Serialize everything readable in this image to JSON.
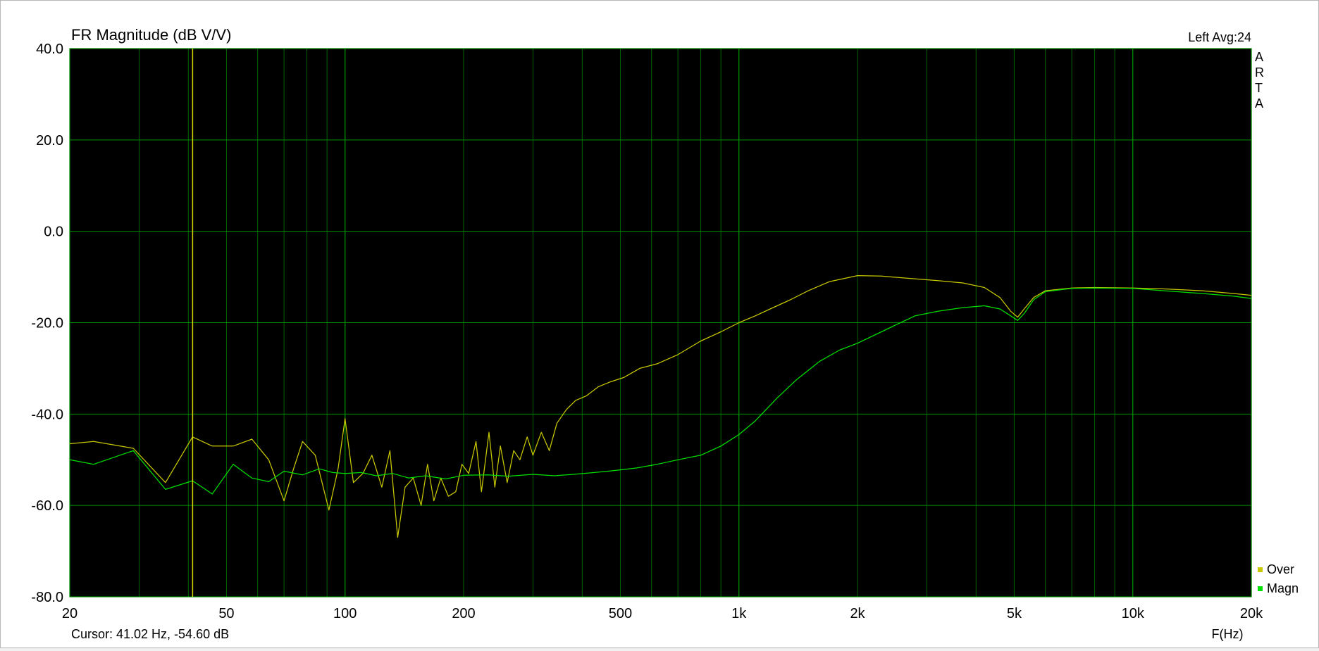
{
  "chart_data": {
    "type": "line",
    "title": "FR Magnitude (dB V/V)",
    "xlabel": "F(Hz)",
    "ylabel": "",
    "x_scale": "log",
    "xlim": [
      20,
      20000
    ],
    "ylim": [
      -80,
      40
    ],
    "grid": true,
    "legend_position": "bottom-right",
    "background_color": "#000000",
    "grid_color": "#006400",
    "major_grid_color": "#009000",
    "x_ticks": [
      20,
      50,
      100,
      200,
      500,
      1000,
      2000,
      5000,
      10000,
      20000
    ],
    "x_tick_labels": [
      "20",
      "50",
      "100",
      "200",
      "500",
      "1k",
      "2k",
      "5k",
      "10k",
      "20k"
    ],
    "x_minor_grid": [
      30,
      40,
      60,
      70,
      80,
      90,
      300,
      400,
      600,
      700,
      800,
      900,
      3000,
      4000,
      6000,
      7000,
      8000,
      9000
    ],
    "x_major_grid": [
      100,
      1000,
      10000
    ],
    "y_ticks": [
      40,
      20,
      0,
      -20,
      -40,
      -60,
      -80
    ],
    "y_tick_labels": [
      "40.0",
      "20.0",
      "0.0",
      "-20.0",
      "-40.0",
      "-60.0",
      "-80.0"
    ],
    "channel_info": "Left   Avg:24",
    "watermark": [
      "A",
      "R",
      "T",
      "A"
    ],
    "cursor": {
      "frequency": 41.02,
      "level": -54.6,
      "label": "Cursor: 41.02 Hz, -54.60 dB",
      "color": "#d8d800"
    },
    "series": [
      {
        "name": "Over",
        "color": "#c8c800",
        "points": [
          [
            20,
            -46.5
          ],
          [
            23,
            -46
          ],
          [
            29,
            -47.5
          ],
          [
            35,
            -55
          ],
          [
            41,
            -45
          ],
          [
            46,
            -47
          ],
          [
            52,
            -47
          ],
          [
            58,
            -45.5
          ],
          [
            64,
            -50
          ],
          [
            70,
            -59
          ],
          [
            74,
            -52
          ],
          [
            78,
            -46
          ],
          [
            84,
            -49
          ],
          [
            91,
            -61
          ],
          [
            96,
            -52
          ],
          [
            100,
            -41
          ],
          [
            105,
            -55
          ],
          [
            111,
            -53
          ],
          [
            117,
            -49
          ],
          [
            124,
            -56
          ],
          [
            130,
            -48
          ],
          [
            136,
            -67
          ],
          [
            142,
            -56
          ],
          [
            149,
            -54
          ],
          [
            156,
            -60
          ],
          [
            162,
            -51
          ],
          [
            168,
            -59
          ],
          [
            175,
            -54
          ],
          [
            183,
            -58
          ],
          [
            191,
            -57
          ],
          [
            198,
            -51
          ],
          [
            206,
            -53
          ],
          [
            215,
            -46
          ],
          [
            222,
            -57
          ],
          [
            232,
            -44
          ],
          [
            240,
            -56
          ],
          [
            248,
            -47
          ],
          [
            258,
            -55
          ],
          [
            268,
            -48
          ],
          [
            278,
            -50
          ],
          [
            290,
            -45
          ],
          [
            300,
            -49
          ],
          [
            315,
            -44
          ],
          [
            330,
            -48
          ],
          [
            345,
            -42
          ],
          [
            365,
            -39
          ],
          [
            385,
            -37
          ],
          [
            410,
            -36
          ],
          [
            440,
            -34
          ],
          [
            470,
            -33
          ],
          [
            510,
            -32
          ],
          [
            560,
            -30
          ],
          [
            620,
            -29
          ],
          [
            700,
            -27
          ],
          [
            800,
            -24
          ],
          [
            900,
            -22
          ],
          [
            1000,
            -20
          ],
          [
            1100,
            -18.5
          ],
          [
            1200,
            -17
          ],
          [
            1350,
            -15
          ],
          [
            1500,
            -13
          ],
          [
            1700,
            -11
          ],
          [
            2000,
            -9.7
          ],
          [
            2300,
            -9.8
          ],
          [
            2700,
            -10.3
          ],
          [
            3200,
            -10.8
          ],
          [
            3700,
            -11.3
          ],
          [
            4200,
            -12.3
          ],
          [
            4600,
            -14.5
          ],
          [
            4900,
            -17.5
          ],
          [
            5100,
            -18.8
          ],
          [
            5300,
            -17
          ],
          [
            5600,
            -14.5
          ],
          [
            6000,
            -13
          ],
          [
            7000,
            -12.4
          ],
          [
            8000,
            -12.3
          ],
          [
            10000,
            -12.4
          ],
          [
            12000,
            -12.6
          ],
          [
            15000,
            -13
          ],
          [
            18000,
            -13.6
          ],
          [
            20000,
            -14
          ]
        ]
      },
      {
        "name": "Magn",
        "color": "#00e000",
        "points": [
          [
            20,
            -50
          ],
          [
            23,
            -51
          ],
          [
            29,
            -48
          ],
          [
            35,
            -56.5
          ],
          [
            41,
            -54.6
          ],
          [
            46,
            -57.5
          ],
          [
            52,
            -51
          ],
          [
            58,
            -54
          ],
          [
            64,
            -54.8
          ],
          [
            70,
            -52.5
          ],
          [
            78,
            -53.3
          ],
          [
            86,
            -52
          ],
          [
            93,
            -52.8
          ],
          [
            100,
            -53
          ],
          [
            110,
            -52.8
          ],
          [
            120,
            -53.5
          ],
          [
            132,
            -53
          ],
          [
            145,
            -54
          ],
          [
            160,
            -53.5
          ],
          [
            180,
            -54.2
          ],
          [
            200,
            -53.4
          ],
          [
            230,
            -53.3
          ],
          [
            260,
            -53.6
          ],
          [
            300,
            -53.2
          ],
          [
            340,
            -53.5
          ],
          [
            380,
            -53.2
          ],
          [
            430,
            -52.8
          ],
          [
            480,
            -52.4
          ],
          [
            550,
            -51.8
          ],
          [
            620,
            -51
          ],
          [
            700,
            -50
          ],
          [
            800,
            -49
          ],
          [
            900,
            -47
          ],
          [
            1000,
            -44.5
          ],
          [
            1100,
            -41.5
          ],
          [
            1250,
            -36.5
          ],
          [
            1400,
            -32.5
          ],
          [
            1600,
            -28.5
          ],
          [
            1800,
            -26
          ],
          [
            2000,
            -24.5
          ],
          [
            2300,
            -22
          ],
          [
            2500,
            -20.5
          ],
          [
            2800,
            -18.5
          ],
          [
            3200,
            -17.5
          ],
          [
            3700,
            -16.7
          ],
          [
            4200,
            -16.3
          ],
          [
            4600,
            -17
          ],
          [
            4900,
            -18.5
          ],
          [
            5100,
            -19.5
          ],
          [
            5300,
            -18
          ],
          [
            5600,
            -15
          ],
          [
            6000,
            -13.2
          ],
          [
            7000,
            -12.5
          ],
          [
            8000,
            -12.4
          ],
          [
            10000,
            -12.5
          ],
          [
            12000,
            -13
          ],
          [
            15000,
            -13.6
          ],
          [
            18000,
            -14.2
          ],
          [
            20000,
            -14.7
          ]
        ]
      }
    ]
  }
}
